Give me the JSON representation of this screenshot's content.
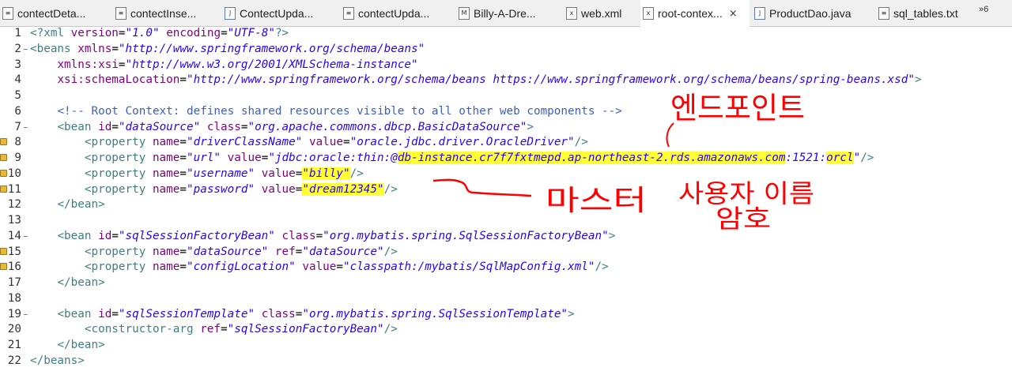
{
  "tabs": [
    {
      "label": "contectDeta...",
      "icon": "file-icon"
    },
    {
      "label": "contectInse...",
      "icon": "file-icon"
    },
    {
      "label": "ContectUpda...",
      "icon": "java-file-icon"
    },
    {
      "label": "contectUpda...",
      "icon": "file-icon"
    },
    {
      "label": "Billy-A-Dre...",
      "icon": "markdown-icon"
    },
    {
      "label": "web.xml",
      "icon": "xml-file-icon"
    },
    {
      "label": "root-contex...",
      "icon": "xml-file-icon",
      "active": true,
      "close": "×"
    },
    {
      "label": "ProductDao.java",
      "icon": "java-file-icon"
    },
    {
      "label": "sql_tables.txt",
      "icon": "text-file-icon"
    }
  ],
  "overflow_label": "»6",
  "colors": {
    "tag": "#3f7f7f",
    "attr": "#7f007f",
    "value": "#2a00ff",
    "comment": "#3f5fbf",
    "highlight": "#ffff33",
    "annotation": "#ff0000"
  },
  "lines": [
    {
      "n": "1",
      "segments": [
        [
          "#3f7f7f",
          "<?xml "
        ],
        [
          "#7f007f",
          "version"
        ],
        [
          "#000",
          "="
        ],
        [
          "#2a00ff",
          "\"1.0\""
        ],
        [
          "#000",
          " "
        ],
        [
          "#7f007f",
          "encoding"
        ],
        [
          "#000",
          "="
        ],
        [
          "#2a00ff",
          "\"UTF-8\""
        ],
        [
          "#3f7f7f",
          "?>"
        ]
      ]
    },
    {
      "n": "2",
      "fold": "−",
      "segments": [
        [
          "#3f7f7f",
          "<beans "
        ],
        [
          "#7f007f",
          "xmlns"
        ],
        [
          "#000",
          "="
        ],
        [
          "#2a00ff",
          "\"http://www.springframework.org/schema/beans\""
        ]
      ]
    },
    {
      "n": "3",
      "segments": [
        [
          "#000",
          "    "
        ],
        [
          "#7f007f",
          "xmlns:xsi"
        ],
        [
          "#000",
          "="
        ],
        [
          "#2a00ff",
          "\"http://www.w3.org/2001/XMLSchema-instance\""
        ]
      ]
    },
    {
      "n": "4",
      "segments": [
        [
          "#000",
          "    "
        ],
        [
          "#7f007f",
          "xsi:schemaLocation"
        ],
        [
          "#000",
          "="
        ],
        [
          "#2a00ff",
          "\"http://www.springframework.org/schema/beans https://www.springframework.org/schema/beans/spring-beans.xsd\""
        ],
        [
          "#3f7f7f",
          ">"
        ]
      ]
    },
    {
      "n": "5",
      "segments": []
    },
    {
      "n": "6",
      "segments": [
        [
          "#000",
          "    "
        ],
        [
          "#3f5fbf",
          "<!-- Root Context: defines shared resources visible to all other web components -->"
        ]
      ]
    },
    {
      "n": "7",
      "fold": "−",
      "segments": [
        [
          "#000",
          "    "
        ],
        [
          "#3f7f7f",
          "<bean "
        ],
        [
          "#7f007f",
          "id"
        ],
        [
          "#000",
          "="
        ],
        [
          "#2a00ff",
          "\"dataSource\""
        ],
        [
          "#000",
          " "
        ],
        [
          "#7f007f",
          "class"
        ],
        [
          "#000",
          "="
        ],
        [
          "#2a00ff",
          "\"org.apache.commons.dbcp.BasicDataSource\""
        ],
        [
          "#3f7f7f",
          ">"
        ]
      ]
    },
    {
      "n": "8",
      "warn": true,
      "segments": [
        [
          "#000",
          "        "
        ],
        [
          "#3f7f7f",
          "<property "
        ],
        [
          "#7f007f",
          "name"
        ],
        [
          "#000",
          "="
        ],
        [
          "#2a00ff",
          "\"driverClassName\""
        ],
        [
          "#000",
          " "
        ],
        [
          "#7f007f",
          "value"
        ],
        [
          "#000",
          "="
        ],
        [
          "#2a00ff",
          "\"oracle.jdbc.driver.OracleDriver\""
        ],
        [
          "#3f7f7f",
          "/>"
        ]
      ]
    },
    {
      "n": "9",
      "warn": true,
      "segments": [
        [
          "#000",
          "        "
        ],
        [
          "#3f7f7f",
          "<property "
        ],
        [
          "#7f007f",
          "name"
        ],
        [
          "#000",
          "="
        ],
        [
          "#2a00ff",
          "\"url\""
        ],
        [
          "#000",
          " "
        ],
        [
          "#7f007f",
          "value"
        ],
        [
          "#000",
          "="
        ],
        [
          "#2a00ff",
          "\"jdbc:oracle:thin:@"
        ],
        [
          "#2a00ff",
          "db-instance.cr7f7fxtmepd.ap-northeast-2.rds.amazonaws.com",
          "hl"
        ],
        [
          "#2a00ff",
          ":1521:"
        ],
        [
          "#2a00ff",
          "orcl",
          "hl"
        ],
        [
          "#2a00ff",
          "\""
        ],
        [
          "#3f7f7f",
          "/>"
        ]
      ]
    },
    {
      "n": "10",
      "warn": true,
      "segments": [
        [
          "#000",
          "        "
        ],
        [
          "#3f7f7f",
          "<property "
        ],
        [
          "#7f007f",
          "name"
        ],
        [
          "#000",
          "="
        ],
        [
          "#2a00ff",
          "\"username\""
        ],
        [
          "#000",
          " "
        ],
        [
          "#7f007f",
          "value"
        ],
        [
          "#000",
          "="
        ],
        [
          "#2a00ff",
          "\"billy\"",
          "hl"
        ],
        [
          "#3f7f7f",
          "/>"
        ]
      ]
    },
    {
      "n": "11",
      "warn": true,
      "segments": [
        [
          "#000",
          "        "
        ],
        [
          "#3f7f7f",
          "<property "
        ],
        [
          "#7f007f",
          "name"
        ],
        [
          "#000",
          "="
        ],
        [
          "#2a00ff",
          "\"password\""
        ],
        [
          "#000",
          " "
        ],
        [
          "#7f007f",
          "value"
        ],
        [
          "#000",
          "="
        ],
        [
          "#2a00ff",
          "\"dream12345\"",
          "hl"
        ],
        [
          "#3f7f7f",
          "/>"
        ]
      ]
    },
    {
      "n": "12",
      "segments": [
        [
          "#000",
          "    "
        ],
        [
          "#3f7f7f",
          "</bean>"
        ]
      ]
    },
    {
      "n": "13",
      "segments": []
    },
    {
      "n": "14",
      "fold": "−",
      "segments": [
        [
          "#000",
          "    "
        ],
        [
          "#3f7f7f",
          "<bean "
        ],
        [
          "#7f007f",
          "id"
        ],
        [
          "#000",
          "="
        ],
        [
          "#2a00ff",
          "\"sqlSessionFactoryBean\""
        ],
        [
          "#000",
          " "
        ],
        [
          "#7f007f",
          "class"
        ],
        [
          "#000",
          "="
        ],
        [
          "#2a00ff",
          "\"org.mybatis.spring.SqlSessionFactoryBean\""
        ],
        [
          "#3f7f7f",
          ">"
        ]
      ]
    },
    {
      "n": "15",
      "warn": true,
      "segments": [
        [
          "#000",
          "        "
        ],
        [
          "#3f7f7f",
          "<property "
        ],
        [
          "#7f007f",
          "name"
        ],
        [
          "#000",
          "="
        ],
        [
          "#2a00ff",
          "\"dataSource\""
        ],
        [
          "#000",
          " "
        ],
        [
          "#7f007f",
          "ref"
        ],
        [
          "#000",
          "="
        ],
        [
          "#2a00ff",
          "\"dataSource\""
        ],
        [
          "#3f7f7f",
          "/>"
        ]
      ]
    },
    {
      "n": "16",
      "warn": true,
      "segments": [
        [
          "#000",
          "        "
        ],
        [
          "#3f7f7f",
          "<property "
        ],
        [
          "#7f007f",
          "name"
        ],
        [
          "#000",
          "="
        ],
        [
          "#2a00ff",
          "\"configLocation\""
        ],
        [
          "#000",
          " "
        ],
        [
          "#7f007f",
          "value"
        ],
        [
          "#000",
          "="
        ],
        [
          "#2a00ff",
          "\"classpath:/mybatis/SqlMapConfig.xml\""
        ],
        [
          "#3f7f7f",
          "/>"
        ]
      ]
    },
    {
      "n": "17",
      "segments": [
        [
          "#000",
          "    "
        ],
        [
          "#3f7f7f",
          "</bean>"
        ]
      ]
    },
    {
      "n": "18",
      "segments": []
    },
    {
      "n": "19",
      "fold": "−",
      "segments": [
        [
          "#000",
          "    "
        ],
        [
          "#3f7f7f",
          "<bean "
        ],
        [
          "#7f007f",
          "id"
        ],
        [
          "#000",
          "="
        ],
        [
          "#2a00ff",
          "\"sqlSessionTemplate\""
        ],
        [
          "#000",
          " "
        ],
        [
          "#7f007f",
          "class"
        ],
        [
          "#000",
          "="
        ],
        [
          "#2a00ff",
          "\"org.mybatis.spring.SqlSessionTemplate\""
        ],
        [
          "#3f7f7f",
          ">"
        ]
      ]
    },
    {
      "n": "20",
      "segments": [
        [
          "#000",
          "        "
        ],
        [
          "#3f7f7f",
          "<constructor-arg "
        ],
        [
          "#7f007f",
          "ref"
        ],
        [
          "#000",
          "="
        ],
        [
          "#2a00ff",
          "\"sqlSessionFactoryBean\""
        ],
        [
          "#3f7f7f",
          "/>"
        ]
      ]
    },
    {
      "n": "21",
      "segments": [
        [
          "#000",
          "    "
        ],
        [
          "#3f7f7f",
          "</bean>"
        ]
      ]
    },
    {
      "n": "22",
      "segments": [
        [
          "#3f7f7f",
          "</beans>"
        ]
      ]
    }
  ],
  "annotations": {
    "endpoint": "엔드포인트",
    "master": "마스터",
    "username": "사용자 이름",
    "password": "암호"
  }
}
